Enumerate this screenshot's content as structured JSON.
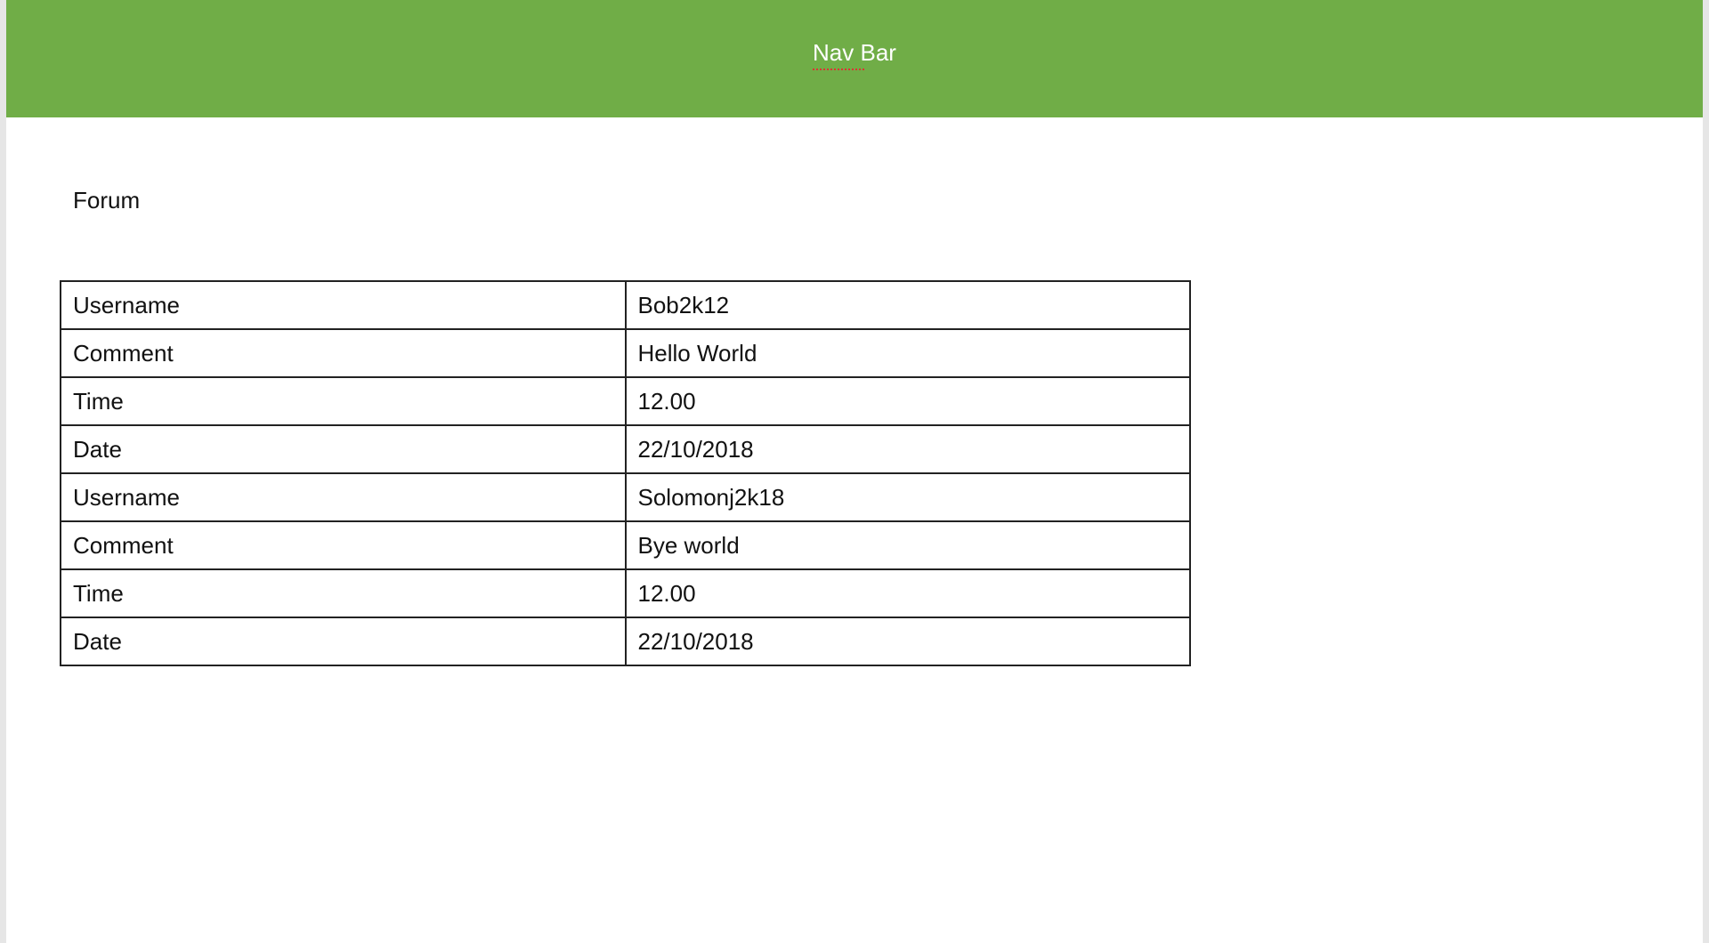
{
  "nav": {
    "title": "Nav Bar"
  },
  "page_title": "Forum",
  "rows": [
    {
      "label": "Username",
      "value": "Bob2k12"
    },
    {
      "label": "Comment",
      "value": "Hello World"
    },
    {
      "label": "Time",
      "value": "12.00"
    },
    {
      "label": "Date",
      "value": "22/10/2018"
    },
    {
      "label": "Username",
      "value": "Solomonj2k18"
    },
    {
      "label": "Comment",
      "value": "Bye world"
    },
    {
      "label": "Time",
      "value": "12.00"
    },
    {
      "label": "Date",
      "value": "22/10/2018"
    }
  ],
  "colors": {
    "nav": "#70ad47"
  }
}
